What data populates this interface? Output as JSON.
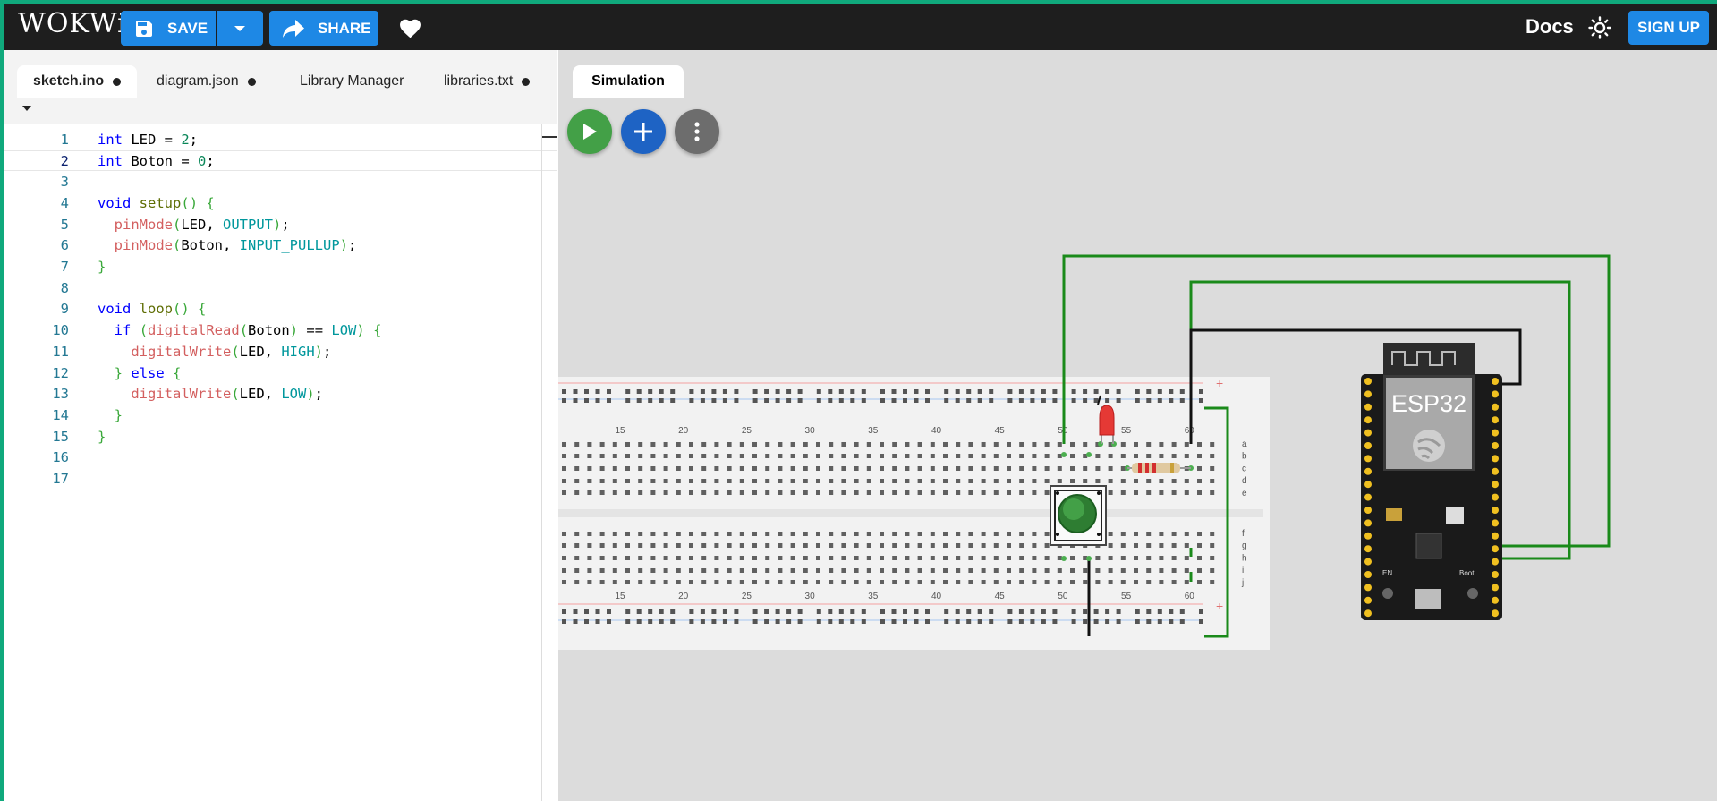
{
  "header": {
    "logo": "WOKWi",
    "save_label": "SAVE",
    "share_label": "SHARE",
    "docs_label": "Docs",
    "signup_label": "SIGN UP"
  },
  "editor": {
    "tabs": [
      {
        "label": "sketch.ino",
        "modified": true,
        "active": true
      },
      {
        "label": "diagram.json",
        "modified": true,
        "active": false
      },
      {
        "label": "Library Manager",
        "modified": false,
        "active": false
      },
      {
        "label": "libraries.txt",
        "modified": true,
        "active": false
      }
    ],
    "current_line": 2,
    "lines": [
      "int LED = 2;",
      "int Boton = 0;",
      "",
      "void setup() {",
      "  pinMode(LED, OUTPUT);",
      "  pinMode(Boton, INPUT_PULLUP);",
      "}",
      "",
      "void loop() {",
      "  if (digitalRead(Boton) == LOW) {",
      "    digitalWrite(LED, HIGH);",
      "  } else {",
      "    digitalWrite(LED, LOW);",
      "  }",
      "}",
      "",
      ""
    ]
  },
  "simulation": {
    "tab_label": "Simulation",
    "board_label": "ESP32",
    "boot_label": "Boot",
    "en_label": "EN",
    "breadboard": {
      "column_labels": [
        "15",
        "20",
        "25",
        "30",
        "35",
        "40",
        "45",
        "50",
        "55",
        "60"
      ],
      "row_labels_top": [
        "a",
        "b",
        "c",
        "d",
        "e"
      ],
      "row_labels_bottom": [
        "f",
        "g",
        "h",
        "i",
        "j"
      ],
      "rail_plus": "+"
    }
  },
  "colors": {
    "accent": "#1e88e5",
    "header_bg": "#1e1e1e",
    "frame": "#10a97c",
    "play": "#43a047",
    "add": "#1e63c4",
    "wire_green": "#1a8a1a"
  }
}
